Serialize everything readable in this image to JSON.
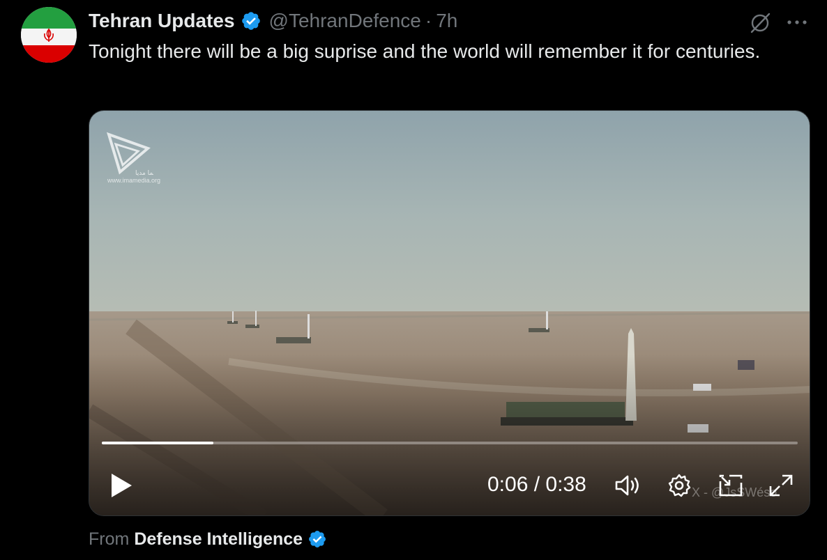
{
  "account": {
    "display_name": "Tehran Updates",
    "handle": "@TehranDefence",
    "separator": "·",
    "time": "7h",
    "verified": true,
    "avatar": "iran-flag-avatar"
  },
  "tweet": {
    "text": "Tonight there will be a big suprise and the world will remember it for centuries."
  },
  "video": {
    "timecode": "0:06 / 0:38",
    "progress": 0.16,
    "overlay_watermark": "X - @JsSWéso",
    "logo_site": "www.imamedia.org",
    "logo_caption": "ایما مدیا",
    "controls": [
      "play-icon",
      "volume-icon",
      "settings-icon",
      "picture-in-picture-icon",
      "fullscreen-icon"
    ]
  },
  "attribution": {
    "prefix": "From",
    "source": "Defense Intelligence",
    "verified": true
  },
  "colors": {
    "background": "#000000",
    "primary_text": "#e7e9ea",
    "secondary_text": "#71767b",
    "verified_blue": "#1d9bf0"
  }
}
